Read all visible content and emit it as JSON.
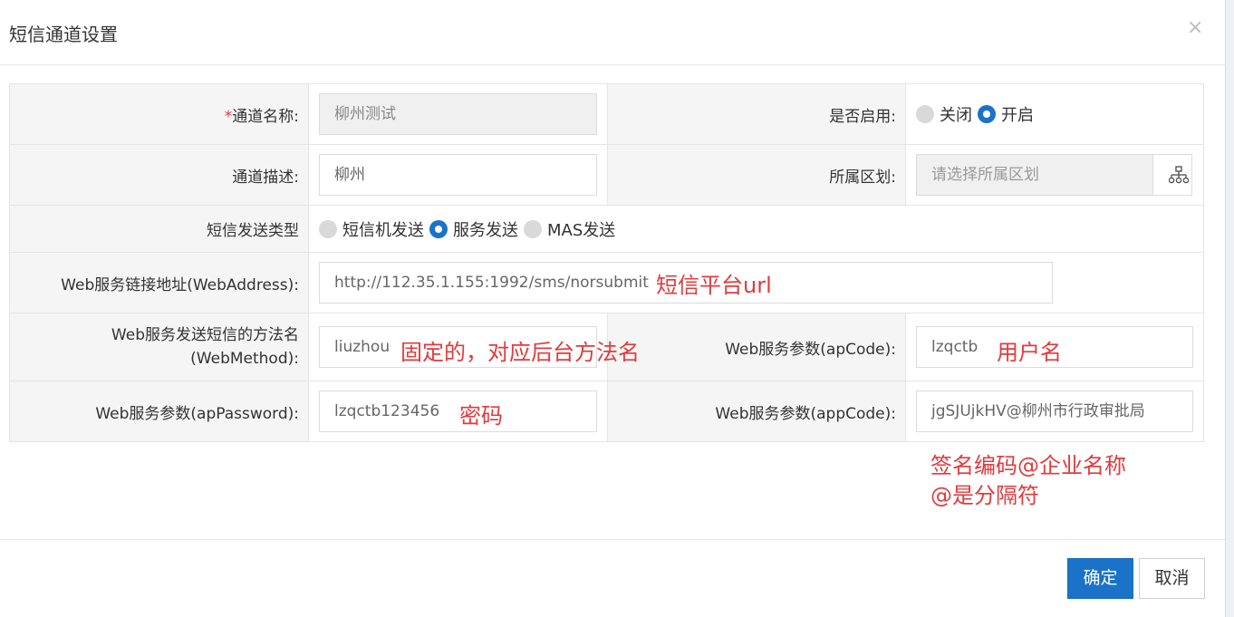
{
  "dialog": {
    "title": "短信通道设置",
    "close_glyph": "×"
  },
  "form": {
    "channel_name": {
      "required_mark": "*",
      "label": "通道名称:",
      "value": "柳州测试"
    },
    "enabled": {
      "label": "是否启用:",
      "options": [
        "关闭",
        "开启"
      ],
      "selected": "开启"
    },
    "channel_desc": {
      "label": "通道描述:",
      "value": "柳州"
    },
    "region": {
      "label": "所属区划:",
      "placeholder": "请选择所属区划",
      "button_icon": "org-tree-icon"
    },
    "send_type": {
      "label": "短信发送类型",
      "options": [
        "短信机发送",
        "服务发送",
        "MAS发送"
      ],
      "selected": "服务发送"
    },
    "web_address": {
      "label": "Web服务链接地址(WebAddress):",
      "value": "http://112.35.1.155:1992/sms/norsubmit"
    },
    "web_method": {
      "label_line1": "Web服务发送短信的方法名",
      "label_line2": "(WebMethod):",
      "value": "liuzhou"
    },
    "ap_code": {
      "label": "Web服务参数(apCode):",
      "value": "lzqctb"
    },
    "ap_password": {
      "label": "Web服务参数(apPassword):",
      "value": "lzqctb123456"
    },
    "app_code": {
      "label": "Web服务参数(appCode):",
      "value": "jgSJUjkHV@柳州市行政审批局"
    }
  },
  "annotations": {
    "url_note": "短信平台url",
    "method_note": "固定的，对应后台方法名",
    "username_note": "用户名",
    "password_note": "密码",
    "signature_note_line1": "签名编码@企业名称",
    "signature_note_line2": "@是分隔符"
  },
  "footer": {
    "confirm_label": "确定",
    "cancel_label": "取消"
  },
  "colors": {
    "accent": "#1a73c8",
    "annotation": "#e4393c",
    "label_bg": "#f5f5f5",
    "required": "#e4393c"
  }
}
